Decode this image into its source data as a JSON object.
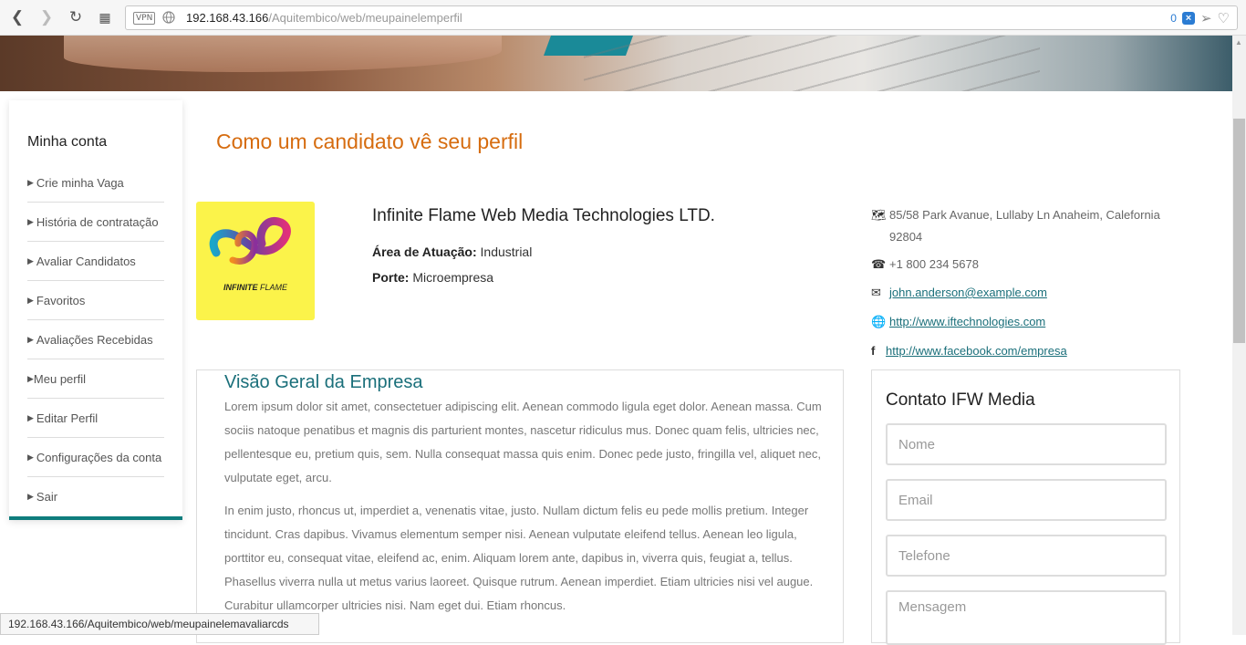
{
  "browser": {
    "vpn_label": "VPN",
    "url_host": "192.168.43.166",
    "url_path": "/Aquitembico/web/meupainelemperfil",
    "tracker_count": "0",
    "status_url": "192.168.43.166/Aquitembico/web/meupainelemavaliarcds"
  },
  "sidebar": {
    "title": "Minha conta",
    "items": [
      {
        "label": "Crie minha Vaga"
      },
      {
        "label": "História de contratação"
      },
      {
        "label": "Avaliar Candidatos"
      },
      {
        "label": "Favoritos"
      },
      {
        "label": "Avaliações Recebidas"
      },
      {
        "label": "Meu perfil"
      },
      {
        "label": "Editar Perfil"
      },
      {
        "label": "Configurações da conta"
      },
      {
        "label": "Sair"
      }
    ]
  },
  "main": {
    "title": "Como um candidato vê seu perfil",
    "logo": {
      "brand_bold": "INFINITE",
      "brand_light": "FLAME"
    },
    "company": {
      "name": "Infinite Flame Web Media Technologies LTD.",
      "area_label": "Área de Atuação:",
      "area_value": "Industrial",
      "size_label": "Porte:",
      "size_value": "Microempresa"
    },
    "contact_info": {
      "address": "85/58 Park Avanue, Lullaby Ln Anaheim, Calefornia 92804",
      "phone": "+1 800 234 5678",
      "email": "john.anderson@example.com",
      "website": "http://www.iftechnologies.com",
      "facebook": "http://www.facebook.com/empresa"
    },
    "overview": {
      "title": "Visão Geral da Empresa",
      "paragraph1": "Lorem ipsum dolor sit amet, consectetuer adipiscing elit. Aenean commodo ligula eget dolor. Aenean massa. Cum sociis natoque penatibus et magnis dis parturient montes, nascetur ridiculus mus. Donec quam felis, ultricies nec, pellentesque eu, pretium quis, sem. Nulla consequat massa quis enim. Donec pede justo, fringilla vel, aliquet nec, vulputate eget, arcu.",
      "paragraph2": "In enim justo, rhoncus ut, imperdiet a, venenatis vitae, justo. Nullam dictum felis eu pede mollis pretium. Integer tincidunt. Cras dapibus. Vivamus elementum semper nisi. Aenean vulputate eleifend tellus. Aenean leo ligula, porttitor eu, consequat vitae, eleifend ac, enim. Aliquam lorem ante, dapibus in, viverra quis, feugiat a, tellus. Phasellus viverra nulla ut metus varius laoreet. Quisque rutrum. Aenean imperdiet. Etiam ultricies nisi vel augue. Curabitur ullamcorper ultricies nisi. Nam eget dui. Etiam rhoncus."
    },
    "contact_form": {
      "title": "Contato IFW Media",
      "name_placeholder": "Nome",
      "email_placeholder": "Email",
      "phone_placeholder": "Telefone",
      "message_placeholder": "Mensagem"
    }
  },
  "colors": {
    "accent_orange": "#d66c0f",
    "accent_teal": "#1a6f7a",
    "logo_bg": "#fbf34a"
  }
}
